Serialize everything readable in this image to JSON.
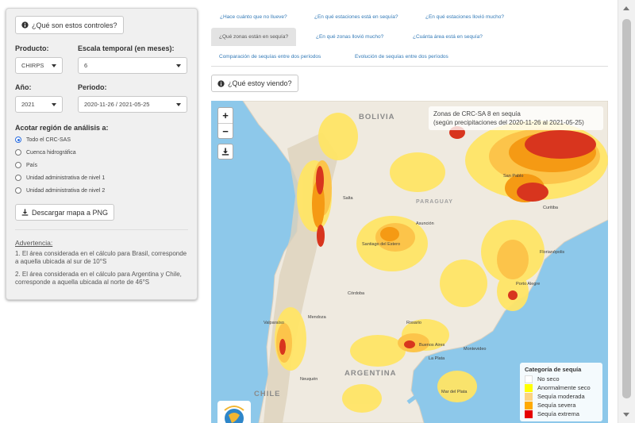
{
  "sidebar": {
    "help_button": "¿Qué son estos controles?",
    "product_label": "Producto:",
    "product_value": "CHIRPS",
    "scale_label": "Escala temporal (en meses):",
    "scale_value": "6",
    "year_label": "Año:",
    "year_value": "2021",
    "period_label": "Periodo:",
    "period_value": "2020-11-26 / 2021-05-25",
    "region_label": "Acotar región de análisis a:",
    "region_options": [
      "Todo el CRC-SAS",
      "Cuenca hidrográfica",
      "País",
      "Unidad administrativa de nivel 1",
      "Unidad administrativa de nivel 2"
    ],
    "download_button": "Descargar mapa a PNG",
    "warning_title": "Advertencia:",
    "warning_1": "1. El área considerada en el cálculo para Brasil, corresponde a aquella ubicada al sur de 10°S",
    "warning_2": "2. El área considerada en el cálculo para Argentina y Chile, corresponde a aquella ubicada al norte de 46°S"
  },
  "tabs": [
    "¿Hace cuánto que no llueve?",
    "¿En qué estaciones está en sequía?",
    "¿En qué estaciones llovió mucho?",
    "¿Qué zonas están en sequía?",
    "¿En qué zonas llovió mucho?",
    "¿Cuánta área está en sequía?",
    "Comparación de sequías entre dos períodos",
    "Evolución de sequías entre dos períodos"
  ],
  "view_button": "¿Qué estoy viendo?",
  "map": {
    "title_line1": "Zonas de CRC-SA 8 en sequía",
    "title_line2": "(según precipitaciones del 2020-11-26 al 2021-05-25)",
    "legend_title": "Categoría de sequía",
    "legend": [
      {
        "label": "No seco",
        "color": "#ffffff"
      },
      {
        "label": "Anormalmente seco",
        "color": "#ffff00"
      },
      {
        "label": "Sequía moderada",
        "color": "#fcd37f"
      },
      {
        "label": "Sequía severa",
        "color": "#ffaa00"
      },
      {
        "label": "Sequía extrema",
        "color": "#e60000"
      }
    ],
    "countries": [
      "BOLIVIA",
      "PARAGUAY",
      "ARGENTINA",
      "CHILE"
    ],
    "places": [
      "Asunción",
      "Curitiba",
      "Florianópolis",
      "Porto Alegre",
      "Buenos Aires",
      "Rosario",
      "Montevideo",
      "Mar del Plata",
      "Valparaíso",
      "Santiago del Estero",
      "Córdoba",
      "Salta",
      "Neuquén",
      "Mendoza",
      "San Pablo",
      "La Plata"
    ],
    "zoom_in": "+",
    "zoom_out": "−"
  }
}
